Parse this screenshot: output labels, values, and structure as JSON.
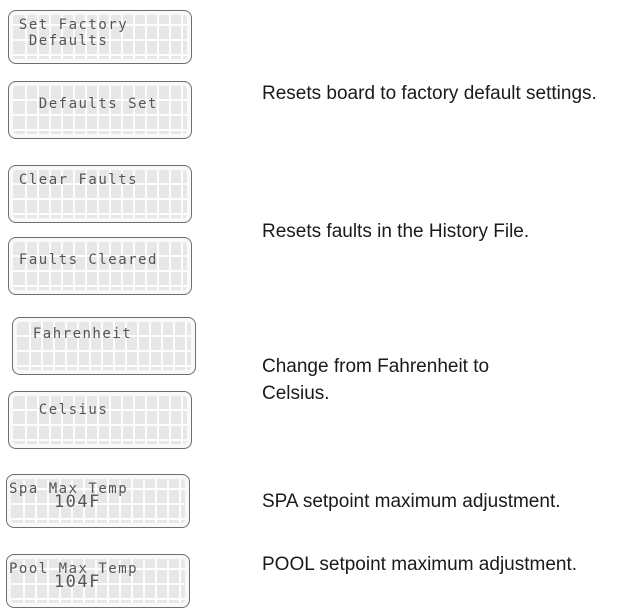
{
  "displays": [
    {
      "line1": " Set Factory",
      "line2": "  Defaults"
    },
    {
      "line1": "",
      "line2": "   Defaults Set"
    },
    {
      "line1": " Clear Faults",
      "line2": ""
    },
    {
      "line1": "",
      "line2": " Faults Cleared"
    },
    {
      "line1": "  Fahrenheit",
      "line2": ""
    },
    {
      "line1": "",
      "line2": "   Celsius"
    },
    {
      "line1": "Spa Max Temp",
      "line2": "    104F"
    },
    {
      "line1": "Pool Max Temp",
      "line2": "    104F"
    }
  ],
  "descriptions": [
    "Resets board to factory default settings.",
    "Resets faults in the History File.",
    "Change from Fahrenheit to Celsius.",
    "SPA setpoint maximum adjustment.",
    "POOL setpoint maximum adjustment."
  ]
}
